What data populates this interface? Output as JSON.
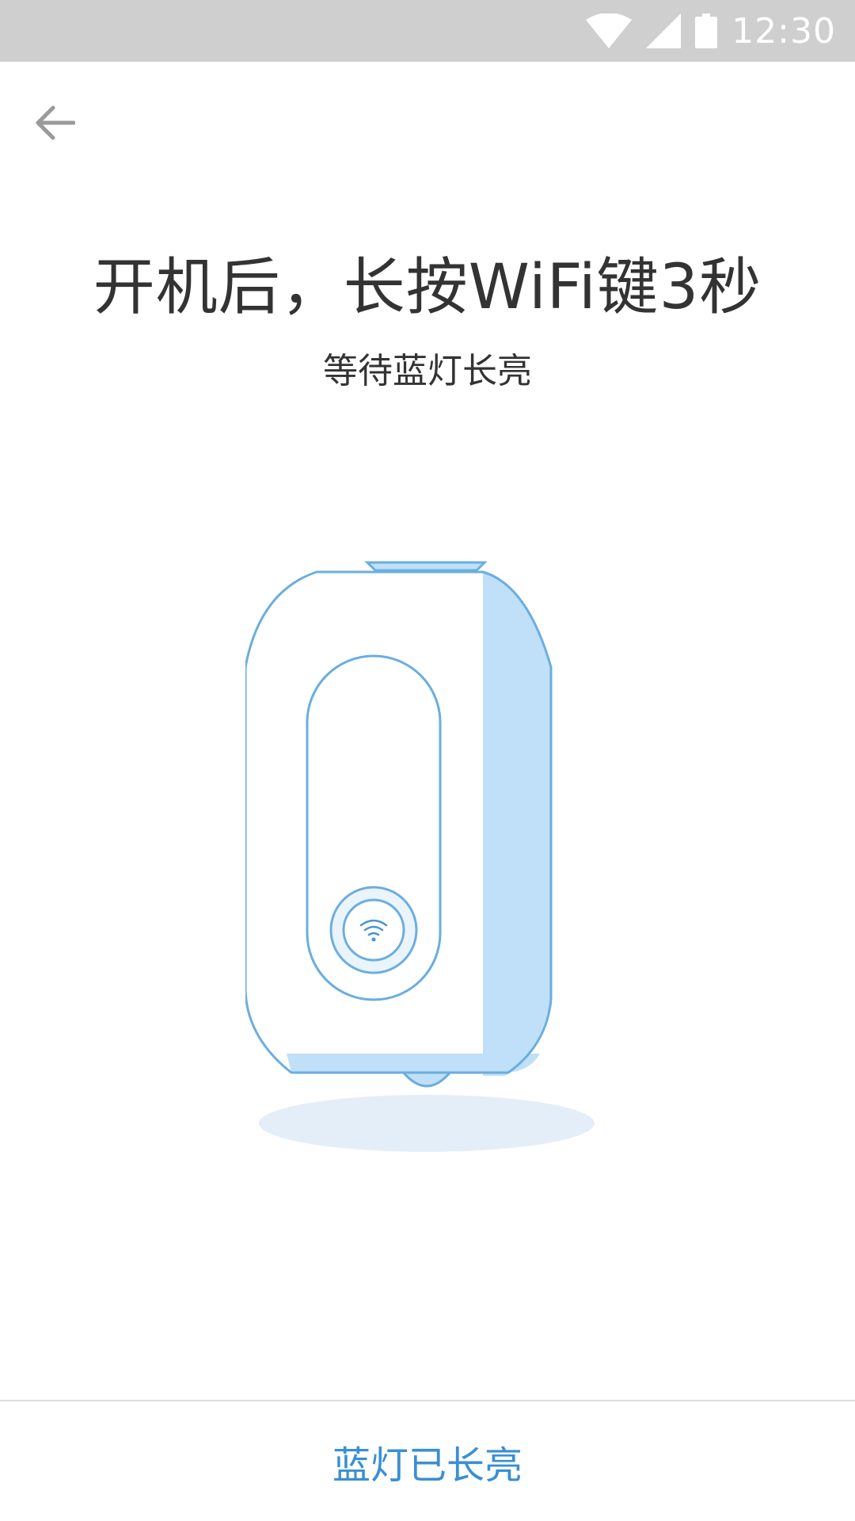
{
  "status_bar": {
    "time": "12:30",
    "icons": [
      "wifi-icon",
      "cellular-signal-icon",
      "battery-icon"
    ]
  },
  "nav": {
    "back_icon": "arrow-left-icon"
  },
  "instructions": {
    "title": "开机后，长按WiFi键3秒",
    "subtitle": "等待蓝灯长亮"
  },
  "illustration": {
    "icon": "wifi-icon"
  },
  "footer": {
    "confirm_label": "蓝灯已长亮"
  },
  "colors": {
    "status_bar_bg": "#cfcfcf",
    "accent": "#3a8fd3",
    "device_stroke": "#6aaee0",
    "device_fill_light": "#bfe0f8",
    "shadow": "#e4eef8",
    "text_primary": "#333333"
  }
}
